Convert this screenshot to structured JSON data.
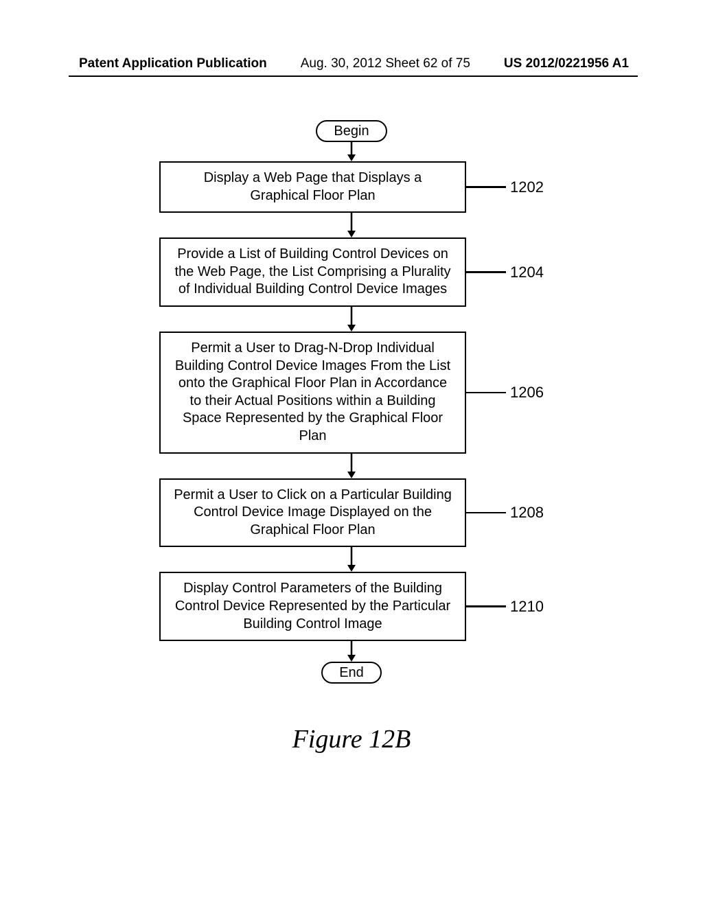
{
  "header": {
    "left": "Patent Application Publication",
    "center": "Aug. 30, 2012  Sheet 62 of 75",
    "right": "US 2012/0221956 A1"
  },
  "flow": {
    "begin": "Begin",
    "end": "End",
    "steps": [
      {
        "ref": "1202",
        "text": "Display a Web Page that Displays a Graphical Floor Plan"
      },
      {
        "ref": "1204",
        "text": "Provide a List of Building Control Devices on the Web Page, the List Comprising a Plurality of Individual Building Control Device Images"
      },
      {
        "ref": "1206",
        "text": "Permit a User to Drag-N-Drop Individual Building Control Device Images From the List onto the Graphical Floor Plan in Accordance to their Actual Positions within a Building Space Represented by the Graphical Floor Plan"
      },
      {
        "ref": "1208",
        "text": "Permit a User to Click on a Particular Building Control Device Image Displayed on the Graphical Floor Plan"
      },
      {
        "ref": "1210",
        "text": "Display Control Parameters of the Building Control Device Represented by the Particular Building Control Image"
      }
    ]
  },
  "caption": "Figure 12B"
}
